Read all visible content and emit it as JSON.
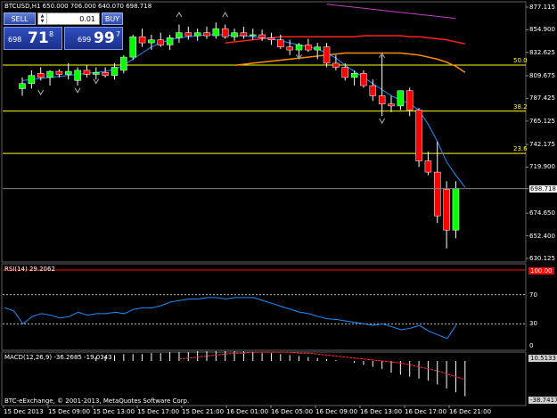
{
  "header": {
    "info": "BTCUSD,H1  650.000 706.000 640.070 698.718"
  },
  "trade_panel": {
    "sell_label": "SELL",
    "buy_label": "BUY",
    "lot_value": "0.01",
    "sell_price_small": "698",
    "sell_price_big": "71",
    "sell_price_sup": "8",
    "buy_price_small": "699",
    "buy_price_big": "99",
    "buy_price_sup": "7"
  },
  "price_axis": {
    "ticks": [
      "877.115",
      "854.900",
      "832.625",
      "809.675",
      "787.425",
      "765.125",
      "742.175",
      "719.900",
      "698.718",
      "674.650",
      "652.400",
      "630.125"
    ],
    "current": "698.718"
  },
  "fibo": [
    "50.0",
    "38.2",
    "23.6"
  ],
  "rsi": {
    "label": "RSI(14) 29.2062",
    "levels": [
      "70",
      "30",
      "0"
    ],
    "badge": "100.00"
  },
  "macd": {
    "label": "MACD(12,26,9) -36.2685 -19.0343",
    "badge_top": "10.5133",
    "badge_bottom": "-38.7417"
  },
  "copyright": "BTC-eExchange, © 2001-2013, MetaQuotes Software Corp.",
  "time_axis": [
    "15 Dec 2013",
    "15 Dec 09:00",
    "15 Dec 13:00",
    "15 Dec 17:00",
    "15 Dec 21:00",
    "16 Dec 01:00",
    "16 Dec 05:00",
    "16 Dec 09:00",
    "16 Dec 13:00",
    "16 Dec 17:00",
    "16 Dec 21:00"
  ],
  "colors": {
    "bull": "#00ff00",
    "bear": "#ff0000",
    "fibo": "#ffff00",
    "ma_fast": "#1e90ff",
    "ma_red": "#ff2020",
    "ma_orange": "#ff8c00",
    "ma_violet": "#c040c0",
    "rsi_line": "#1e90ff",
    "macd_signal": "#ff3030"
  },
  "chart_data": {
    "type": "candlestick",
    "candles": [
      {
        "o": 797,
        "h": 808,
        "l": 790,
        "c": 802
      },
      {
        "o": 802,
        "h": 815,
        "l": 797,
        "c": 810
      },
      {
        "o": 812,
        "h": 818,
        "l": 805,
        "c": 808
      },
      {
        "o": 808,
        "h": 815,
        "l": 800,
        "c": 814
      },
      {
        "o": 814,
        "h": 816,
        "l": 808,
        "c": 811
      },
      {
        "o": 811,
        "h": 822,
        "l": 806,
        "c": 814
      },
      {
        "o": 805,
        "h": 818,
        "l": 800,
        "c": 815
      },
      {
        "o": 815,
        "h": 820,
        "l": 808,
        "c": 811
      },
      {
        "o": 811,
        "h": 818,
        "l": 806,
        "c": 813
      },
      {
        "o": 813,
        "h": 818,
        "l": 808,
        "c": 810
      },
      {
        "o": 810,
        "h": 822,
        "l": 806,
        "c": 818
      },
      {
        "o": 815,
        "h": 830,
        "l": 812,
        "c": 828
      },
      {
        "o": 828,
        "h": 850,
        "l": 825,
        "c": 848
      },
      {
        "o": 848,
        "h": 856,
        "l": 838,
        "c": 842
      },
      {
        "o": 842,
        "h": 850,
        "l": 835,
        "c": 845
      },
      {
        "o": 845,
        "h": 852,
        "l": 838,
        "c": 840
      },
      {
        "o": 840,
        "h": 850,
        "l": 835,
        "c": 847
      },
      {
        "o": 847,
        "h": 860,
        "l": 842,
        "c": 852
      },
      {
        "o": 852,
        "h": 858,
        "l": 845,
        "c": 849
      },
      {
        "o": 849,
        "h": 856,
        "l": 844,
        "c": 852
      },
      {
        "o": 852,
        "h": 858,
        "l": 846,
        "c": 849
      },
      {
        "o": 849,
        "h": 862,
        "l": 846,
        "c": 856
      },
      {
        "o": 856,
        "h": 860,
        "l": 846,
        "c": 848
      },
      {
        "o": 848,
        "h": 856,
        "l": 844,
        "c": 852
      },
      {
        "o": 852,
        "h": 858,
        "l": 846,
        "c": 849
      },
      {
        "o": 849,
        "h": 856,
        "l": 845,
        "c": 850
      },
      {
        "o": 850,
        "h": 855,
        "l": 844,
        "c": 847
      },
      {
        "o": 847,
        "h": 852,
        "l": 840,
        "c": 845
      },
      {
        "o": 845,
        "h": 850,
        "l": 836,
        "c": 838
      },
      {
        "o": 838,
        "h": 845,
        "l": 830,
        "c": 835
      },
      {
        "o": 835,
        "h": 842,
        "l": 828,
        "c": 840
      },
      {
        "o": 840,
        "h": 846,
        "l": 833,
        "c": 835
      },
      {
        "o": 835,
        "h": 842,
        "l": 826,
        "c": 838
      },
      {
        "o": 838,
        "h": 842,
        "l": 818,
        "c": 822
      },
      {
        "o": 822,
        "h": 830,
        "l": 815,
        "c": 818
      },
      {
        "o": 818,
        "h": 822,
        "l": 805,
        "c": 808
      },
      {
        "o": 808,
        "h": 815,
        "l": 800,
        "c": 812
      },
      {
        "o": 812,
        "h": 815,
        "l": 798,
        "c": 800
      },
      {
        "o": 800,
        "h": 806,
        "l": 785,
        "c": 790
      },
      {
        "o": 790,
        "h": 830,
        "l": 770,
        "c": 782
      },
      {
        "o": 782,
        "h": 790,
        "l": 774,
        "c": 780
      },
      {
        "o": 780,
        "h": 795,
        "l": 776,
        "c": 795
      },
      {
        "o": 795,
        "h": 798,
        "l": 770,
        "c": 776
      },
      {
        "o": 776,
        "h": 778,
        "l": 720,
        "c": 726
      },
      {
        "o": 726,
        "h": 735,
        "l": 712,
        "c": 715
      },
      {
        "o": 715,
        "h": 745,
        "l": 665,
        "c": 672
      },
      {
        "o": 698,
        "h": 706,
        "l": 640,
        "c": 658
      },
      {
        "o": 658,
        "h": 706,
        "l": 650,
        "c": 699
      }
    ],
    "ma_fast": [
      805,
      806,
      807,
      808,
      809,
      810,
      811,
      812,
      813,
      814,
      816,
      820,
      826,
      832,
      838,
      842,
      845,
      847,
      848,
      849,
      850,
      850,
      850,
      849,
      849,
      848,
      847,
      846,
      844,
      842,
      840,
      838,
      836,
      832,
      827,
      820,
      814,
      808,
      802,
      796,
      790,
      786,
      782,
      776,
      762,
      745,
      725,
      712,
      700
    ],
    "ma_red": [
      842,
      843,
      844,
      845,
      846,
      847,
      848,
      848,
      848,
      848,
      848,
      848,
      848,
      848,
      848,
      849,
      849,
      849,
      849,
      849,
      848,
      848,
      847,
      846,
      845,
      843,
      841
    ],
    "ma_orange": [
      820,
      821,
      822,
      823,
      824,
      825,
      826,
      827,
      828,
      829,
      830,
      831,
      832,
      832,
      832,
      832,
      832,
      832,
      832,
      831,
      830,
      828,
      826,
      823,
      819,
      813
    ],
    "ma_violet": [
      880,
      879,
      878,
      877,
      876,
      875,
      874,
      873,
      872,
      871,
      870,
      869,
      868,
      867,
      866
    ],
    "fibo_levels": [
      820.2,
      775.0,
      733.4
    ],
    "y_min": 630.125,
    "y_max": 877.115,
    "rsi_values": [
      52,
      48,
      30,
      40,
      44,
      42,
      38,
      40,
      46,
      42,
      44,
      44,
      46,
      44,
      50,
      52,
      52,
      55,
      60,
      62,
      64,
      64,
      66,
      66,
      64,
      66,
      66,
      66,
      62,
      58,
      54,
      50,
      46,
      44,
      40,
      37,
      36,
      34,
      32,
      30,
      28,
      30,
      26,
      22,
      24,
      28,
      20,
      15,
      10,
      29
    ],
    "macd_hist": [
      4,
      5,
      6,
      7,
      7,
      7,
      8,
      8,
      9,
      9,
      9,
      10,
      10,
      10,
      10,
      10,
      10,
      9,
      8,
      8,
      7,
      6,
      5,
      4,
      3,
      2,
      1,
      0,
      -2,
      -4,
      -6,
      -8,
      -12,
      -14,
      -16,
      -18,
      -20,
      -24,
      -28,
      -32,
      -36
    ],
    "macd_signal": [
      2,
      3,
      4,
      5,
      6,
      7,
      8,
      8,
      9,
      9,
      9,
      9,
      9,
      8,
      8,
      7,
      6,
      5,
      4,
      3,
      2,
      1,
      0,
      -1,
      -2,
      -4,
      -6,
      -8,
      -10,
      -13,
      -16,
      -19
    ]
  }
}
